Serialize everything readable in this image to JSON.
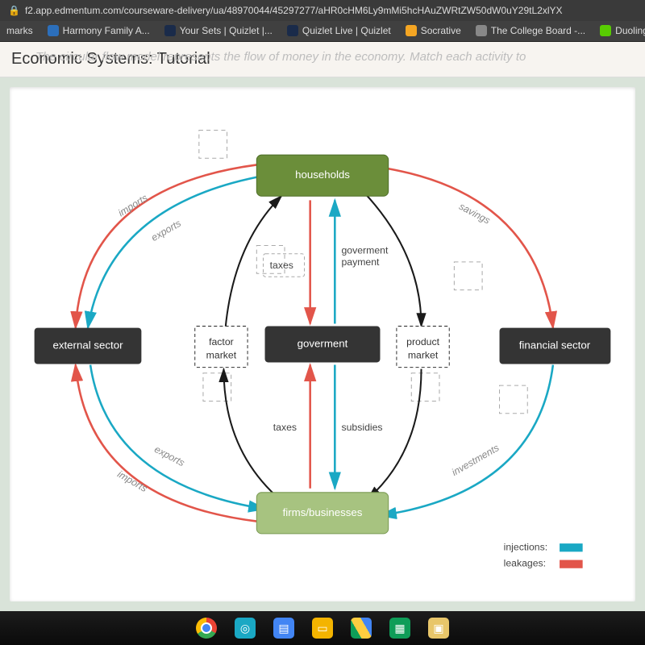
{
  "url": "f2.app.edmentum.com/courseware-delivery/ua/48970044/45297277/aHR0cHM6Ly9mMi5hcHAuZWRtZW50dW0uY29tL2xlYX",
  "bookmarks": [
    {
      "label": "marks"
    },
    {
      "label": "Harmony Family A..."
    },
    {
      "label": "Your Sets | Quizlet |..."
    },
    {
      "label": "Quizlet Live | Quizlet"
    },
    {
      "label": "Socrative"
    },
    {
      "label": "The College Board -..."
    },
    {
      "label": "Duoling"
    }
  ],
  "page": {
    "title": "Economic Systems: Tutorial",
    "ghost": "The circular flow model represents the flow of money in the economy. Match each activity to"
  },
  "diagram": {
    "nodes": {
      "households": "households",
      "external": "external sector",
      "factor": "factor\nmarket",
      "government": "goverment",
      "product": "product\nmarket",
      "financial": "financial sector",
      "firms": "firms/businesses"
    },
    "labels": {
      "imports_top": "imports",
      "exports_top": "exports",
      "savings": "savings",
      "taxes_up": "taxes",
      "gov_payment": "goverment\npayment",
      "taxes_down": "taxes",
      "subsidies": "subsidies",
      "exports_bot": "exports",
      "imports_bot": "imports",
      "investments": "investments"
    },
    "legend": {
      "injections": "injections:",
      "leakages": "leakages:"
    }
  },
  "taskbar_apps": [
    "chrome",
    "edmentum",
    "docs",
    "slides",
    "drive",
    "sheets",
    "classroom"
  ]
}
